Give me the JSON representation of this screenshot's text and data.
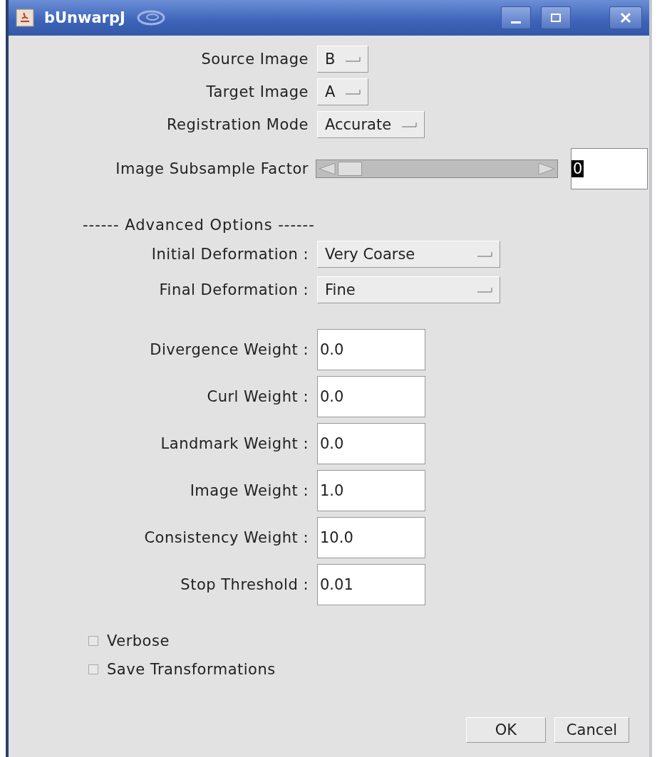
{
  "window": {
    "title": "bUnwarpJ"
  },
  "choices": [
    {
      "label": "Source Image",
      "value": "B"
    },
    {
      "label": "Target Image",
      "value": "A"
    },
    {
      "label": "Registration Mode",
      "value": "Accurate"
    }
  ],
  "subsample": {
    "label": "Image Subsample Factor",
    "level": 0,
    "value": "0"
  },
  "advanced_heading": "------ Advanced Options ------",
  "deformations": [
    {
      "label": "Initial Deformation :",
      "value": "Very Coarse"
    },
    {
      "label": "Final Deformation :",
      "value": "Fine"
    }
  ],
  "weights": [
    {
      "label": "Divergence Weight :",
      "value": "0.0"
    },
    {
      "label": "Curl Weight :",
      "value": "0.0"
    },
    {
      "label": "Landmark Weight :",
      "value": "0.0"
    },
    {
      "label": "Image Weight :",
      "value": "1.0"
    },
    {
      "label": "Consistency Weight :",
      "value": "10.0"
    },
    {
      "label": "Stop Threshold :",
      "value": "0.01"
    }
  ],
  "checkboxes": [
    {
      "label": "Verbose",
      "checked": false
    },
    {
      "label": "Save Transformations",
      "checked": false
    }
  ],
  "buttons": [
    "OK",
    "Cancel"
  ]
}
